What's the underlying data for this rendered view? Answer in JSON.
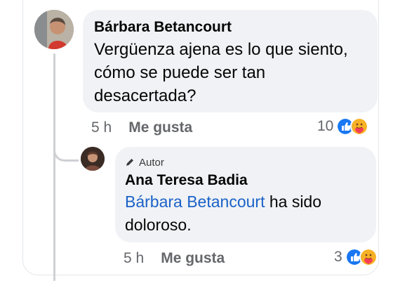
{
  "thread": {
    "comments": [
      {
        "author": "Bárbara Betancourt",
        "text": "Vergüenza ajena es lo que siento, cómo se puede ser tan desacertada?",
        "time": "5 h",
        "like_label": "Me gusta",
        "reaction_count": "10",
        "reactions": [
          "like-icon",
          "care-icon"
        ]
      }
    ],
    "reply": {
      "badge_label": "Autor",
      "author": "Ana Teresa Badia",
      "mention": "Bárbara Betancourt",
      "text": " ha sido doloroso.",
      "time": "5 h",
      "like_label": "Me gusta",
      "reaction_count": "3",
      "reactions": [
        "like-icon",
        "care-icon"
      ]
    }
  },
  "colors": {
    "bubble": "#f0f2f5",
    "mention": "#1b62c8",
    "like_blue": "#1877f2",
    "care_yellow": "#f7b125",
    "muted_text": "#65676b"
  }
}
